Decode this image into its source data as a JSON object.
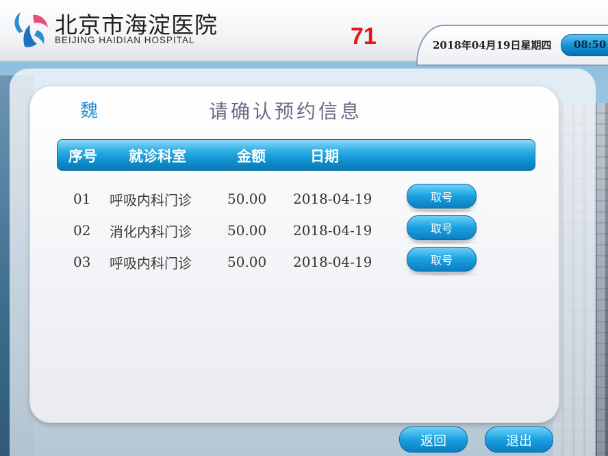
{
  "header": {
    "hospital_name_cn": "北京市海淀医院",
    "hospital_name_en": "BEIJING HAIDIAN HOSPITAL",
    "queue_number": "71",
    "date": "2018年04月19日星期四",
    "time": "08:50"
  },
  "main": {
    "patient_name": "魏",
    "title": "请确认预约信息",
    "columns": [
      "序号",
      "就诊科室",
      "金额",
      "日期"
    ],
    "rows": [
      {
        "no": "01",
        "dept": "呼吸内科门诊",
        "amount": "50.00",
        "date": "2018-04-19",
        "action": "取号"
      },
      {
        "no": "02",
        "dept": "消化内科门诊",
        "amount": "50.00",
        "date": "2018-04-19",
        "action": "取号"
      },
      {
        "no": "03",
        "dept": "呼吸内科门诊",
        "amount": "50.00",
        "date": "2018-04-19",
        "action": "取号"
      }
    ]
  },
  "footer": {
    "back_label": "返回",
    "exit_label": "退出"
  },
  "colors": {
    "accent_blue": "#1aa0e0",
    "queue_red": "#e8141b",
    "title_gray": "#6a6a82"
  }
}
